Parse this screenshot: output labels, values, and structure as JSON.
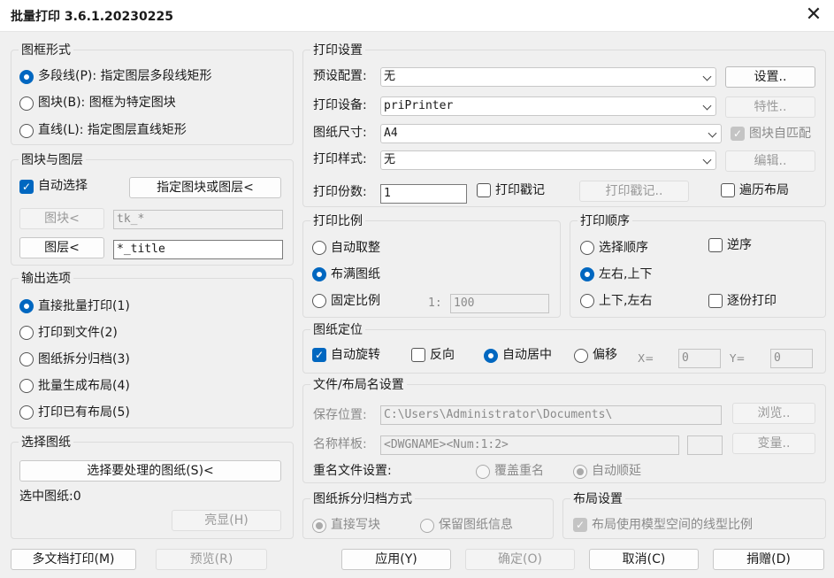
{
  "window": {
    "title": "批量打印 3.6.1.20230225",
    "close_glyph": "✕"
  },
  "frame_type": {
    "title": "图框形式",
    "options": [
      {
        "label": "多段线(P): 指定图层多段线矩形",
        "selected": true
      },
      {
        "label": "图块(B): 图框为特定图块",
        "selected": false
      },
      {
        "label": "直线(L): 指定图层直线矩形",
        "selected": false
      }
    ]
  },
  "block_layer": {
    "title": "图块与图层",
    "auto_select": {
      "label": "自动选择",
      "checked": true
    },
    "specify_button": "指定图块或图层<",
    "block_button": "图块<",
    "block_value": "tk_*",
    "layer_button": "图层<",
    "layer_value": "*_title"
  },
  "output": {
    "title": "输出选项",
    "options": [
      {
        "label": "直接批量打印(1)",
        "selected": true
      },
      {
        "label": "打印到文件(2)",
        "selected": false
      },
      {
        "label": "图纸拆分归档(3)",
        "selected": false
      },
      {
        "label": "批量生成布局(4)",
        "selected": false
      },
      {
        "label": "打印已有布局(5)",
        "selected": false
      }
    ]
  },
  "select_sheets": {
    "title": "选择图纸",
    "select_button": "选择要处理的图纸(S)<",
    "selected_label": "选中图纸:0",
    "highlight_button": "亮显(H)"
  },
  "print_settings": {
    "title": "打印设置",
    "preset_label": "预设配置:",
    "preset_value": "无",
    "setup_button": "设置..",
    "device_label": "打印设备:",
    "device_value": "priPrinter",
    "properties_button": "特性..",
    "paper_label": "图纸尺寸:",
    "paper_value": "A4",
    "auto_match": {
      "label": "图块自匹配",
      "checked": true
    },
    "style_label": "打印样式:",
    "style_value": "无",
    "edit_button": "编辑..",
    "copies_label": "打印份数:",
    "copies_value": "1",
    "stamp": {
      "label": "打印戳记",
      "checked": false
    },
    "stamp_button": "打印戳记..",
    "traverse": {
      "label": "遍历布局",
      "checked": false
    }
  },
  "scale": {
    "title": "打印比例",
    "options": [
      {
        "label": "自动取整",
        "selected": false
      },
      {
        "label": "布满图纸",
        "selected": true
      },
      {
        "label": "固定比例",
        "selected": false
      }
    ],
    "ratio_prefix": "1:",
    "ratio_value": "100"
  },
  "order": {
    "title": "打印顺序",
    "options": [
      {
        "label": "选择顺序",
        "selected": false
      },
      {
        "label": "左右,上下",
        "selected": true
      },
      {
        "label": "上下,左右",
        "selected": false
      }
    ],
    "reverse": {
      "label": "逆序",
      "checked": false
    },
    "collate": {
      "label": "逐份打印",
      "checked": false
    }
  },
  "position": {
    "title": "图纸定位",
    "auto_rotate": {
      "label": "自动旋转",
      "checked": true
    },
    "flip": {
      "label": "反向",
      "checked": false
    },
    "center": {
      "label": "自动居中",
      "selected": true
    },
    "offset": {
      "label": "偏移",
      "selected": false
    },
    "x_label": "X=",
    "x_value": "0",
    "y_label": "Y=",
    "y_value": "0"
  },
  "file_naming": {
    "title": "文件/布局名设置",
    "save_label": "保存位置:",
    "save_value": "C:\\Users\\Administrator\\Documents\\",
    "browse_button": "浏览..",
    "pattern_label": "名称样板:",
    "pattern_value": "<DWGNAME><Num:1:2>",
    "pattern_extra": "",
    "variables_button": "变量..",
    "rename_label": "重名文件设置:",
    "overwrite": {
      "label": "覆盖重名",
      "selected": false
    },
    "auto_increment": {
      "label": "自动顺延",
      "selected": true
    }
  },
  "split_mode": {
    "title": "图纸拆分归档方式",
    "direct": {
      "label": "直接写块",
      "selected": true
    },
    "keep_info": {
      "label": "保留图纸信息",
      "selected": false
    }
  },
  "layout_settings": {
    "title": "布局设置",
    "linetype_scale": {
      "label": "布局使用模型空间的线型比例",
      "checked": true
    }
  },
  "footer": {
    "multi_doc": "多文档打印(M)",
    "preview": "预览(R)",
    "apply": "应用(Y)",
    "ok": "确定(O)",
    "cancel": "取消(C)",
    "donate": "捐赠(D)"
  }
}
